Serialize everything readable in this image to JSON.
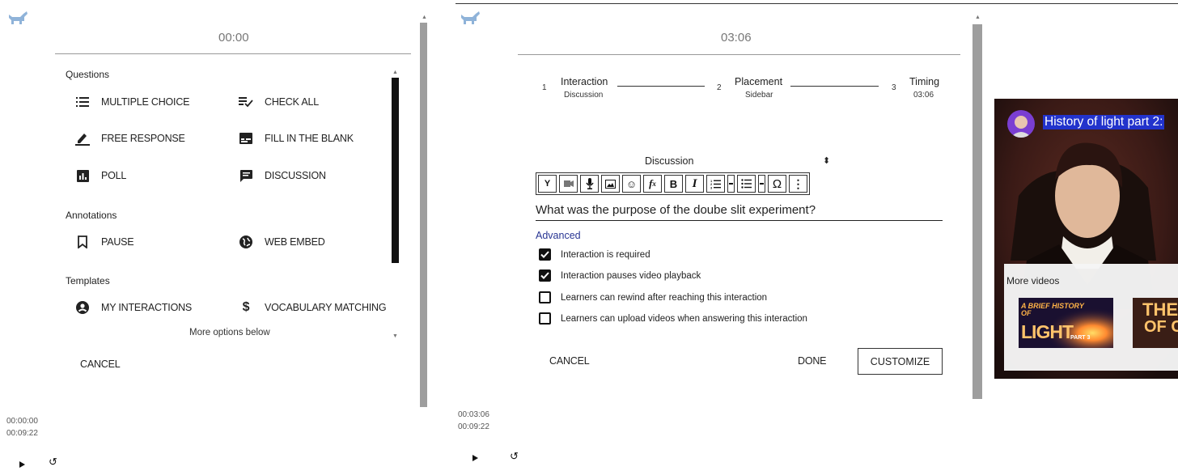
{
  "left": {
    "timer": "00:00",
    "sections": {
      "questions": "Questions",
      "annotations": "Annotations",
      "templates": "Templates"
    },
    "options": {
      "multiple_choice": "MULTIPLE CHOICE",
      "check_all": "CHECK ALL",
      "free_response": "FREE RESPONSE",
      "fill_in_blank": "FILL IN THE BLANK",
      "poll": "POLL",
      "discussion": "DISCUSSION",
      "pause": "PAUSE",
      "web_embed": "WEB EMBED",
      "my_interactions": "MY INTERACTIONS",
      "vocabulary_matching": "VOCABULARY MATCHING"
    },
    "more_options": "More options below",
    "cancel": "CANCEL",
    "time_current": "00:00:00",
    "time_total": "00:09:22"
  },
  "right": {
    "timer": "03:06",
    "steps": [
      {
        "num": "1",
        "title": "Interaction",
        "sub": "Discussion"
      },
      {
        "num": "2",
        "title": "Placement",
        "sub": "Sidebar"
      },
      {
        "num": "3",
        "title": "Timing",
        "sub": "03:06"
      }
    ],
    "type_select": "Discussion",
    "select_arrow": "⬍",
    "question_text": "What was the purpose of the doube slit experiment?",
    "advanced": "Advanced",
    "checkboxes": [
      {
        "label": "Interaction is required",
        "checked": true
      },
      {
        "label": "Interaction pauses video playback",
        "checked": true
      },
      {
        "label": "Learners can rewind after reaching this interaction",
        "checked": false
      },
      {
        "label": "Learners can upload videos when answering this interaction",
        "checked": false
      }
    ],
    "cancel": "CANCEL",
    "done": "DONE",
    "customize": "CUSTOMIZE",
    "time_current": "00:03:06",
    "time_total": "00:09:22"
  },
  "video": {
    "title": "History of light part 2:",
    "more_videos": "More videos",
    "thumb1_line1": "A BRIEF HISTORY",
    "thumb1_line2": "OF",
    "thumb1_line3": "LIGHT",
    "thumb1_part": "PART 3",
    "thumb2_line1": "THE M",
    "thumb2_line2": "OF C"
  },
  "colors": {
    "accent_link": "#283593",
    "title_highlight": "#2233cc",
    "logo": "#8fb3d9"
  }
}
